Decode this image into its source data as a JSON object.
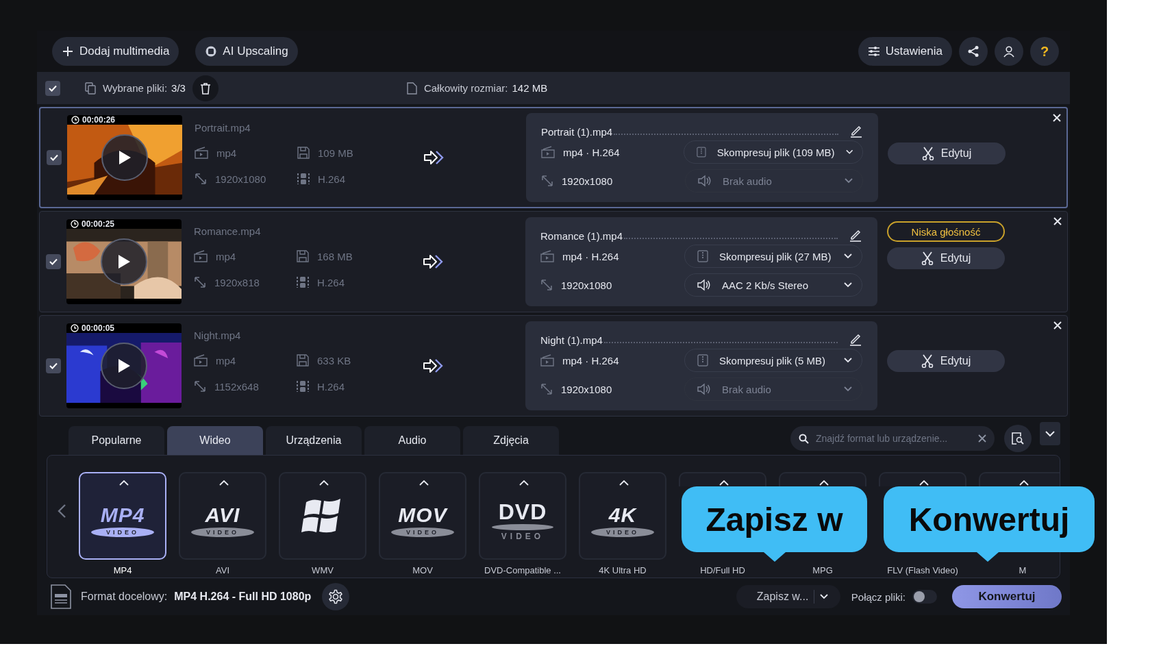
{
  "toolbar": {
    "add_button": "Dodaj multimedia",
    "upscale_button": "AI Upscaling",
    "settings_button": "Ustawienia",
    "help_button": "?"
  },
  "selection_bar": {
    "checked": true,
    "selected_label": "Wybrane pliki:",
    "selected_count": "3/3",
    "size_label": "Całkowity rozmiar:",
    "size_value": "142 MB"
  },
  "files": [
    {
      "selected": true,
      "checked": true,
      "duration": "00:00:26",
      "name": "Portrait.mp4",
      "container": "mp4",
      "size": "109 MB",
      "resolution": "1920x1080",
      "codec": "H.264",
      "output": {
        "name": "Portrait (1).mp4",
        "format": "mp4 · H.264",
        "compress": "Skompresuj plik (109 MB)",
        "resolution": "1920x1080",
        "audio": "Brak audio",
        "audio_disabled": true
      },
      "edit_button": "Edytuj"
    },
    {
      "selected": false,
      "checked": true,
      "duration": "00:00:25",
      "name": "Romance.mp4",
      "container": "mp4",
      "size": "168 MB",
      "resolution": "1920x818",
      "codec": "H.264",
      "output": {
        "name": "Romance (1).mp4",
        "format": "mp4 · H.264",
        "compress": "Skompresuj plik (27 MB)",
        "resolution": "1920x1080",
        "audio": "AAC 2 Kb/s Stereo",
        "audio_disabled": false
      },
      "warning": "Niska głośność",
      "edit_button": "Edytuj"
    },
    {
      "selected": false,
      "checked": true,
      "duration": "00:00:05",
      "name": "Night.mp4",
      "container": "mp4",
      "size": "633 KB",
      "resolution": "1152x648",
      "codec": "H.264",
      "output": {
        "name": "Night (1).mp4",
        "format": "mp4 · H.264",
        "compress": "Skompresuj plik (5 MB)",
        "resolution": "1920x1080",
        "audio": "Brak audio",
        "audio_disabled": true
      },
      "edit_button": "Edytuj"
    }
  ],
  "format_tabs": [
    {
      "label": "Popularne",
      "selected": false
    },
    {
      "label": "Wideo",
      "selected": true
    },
    {
      "label": "Urządzenia",
      "selected": false
    },
    {
      "label": "Audio",
      "selected": false
    },
    {
      "label": "Zdjęcia",
      "selected": false
    }
  ],
  "format_search": {
    "placeholder": "Znajdź format lub urządzenie..."
  },
  "formats": [
    {
      "label": "MP4",
      "selected": true,
      "kind": "pill",
      "logo_text": "MP4",
      "logo_sub": "VIDEO"
    },
    {
      "label": "AVI",
      "selected": false,
      "kind": "pill",
      "logo_text": "AVI",
      "logo_sub": "VIDEO"
    },
    {
      "label": "WMV",
      "selected": false,
      "kind": "windows"
    },
    {
      "label": "MOV",
      "selected": false,
      "kind": "pill",
      "logo_text": "MOV",
      "logo_sub": "VIDEO"
    },
    {
      "label": "DVD-Compatible ...",
      "selected": false,
      "kind": "dvd",
      "logo_text": "DVD",
      "logo_sub": "VIDEO"
    },
    {
      "label": "4K Ultra HD",
      "selected": false,
      "kind": "pill",
      "logo_text": "4K",
      "logo_sub": "VIDEO"
    },
    {
      "label": "HD/Full HD",
      "selected": false,
      "kind": "covered"
    },
    {
      "label": "MPG",
      "selected": false,
      "kind": "covered"
    },
    {
      "label": "FLV (Flash Video)",
      "selected": false,
      "kind": "covered"
    },
    {
      "label": "M",
      "selected": false,
      "kind": "covered"
    }
  ],
  "bottom_bar": {
    "target_label": "Format docelowy:",
    "target_value": "MP4 H.264 - Full HD 1080p",
    "save_button": "Zapisz w...",
    "merge_label": "Połącz pliki:",
    "merge_on": false,
    "convert_button": "Konwertuj"
  },
  "callouts": [
    {
      "text": "Zapisz w"
    },
    {
      "text": "Konwertuj"
    }
  ]
}
